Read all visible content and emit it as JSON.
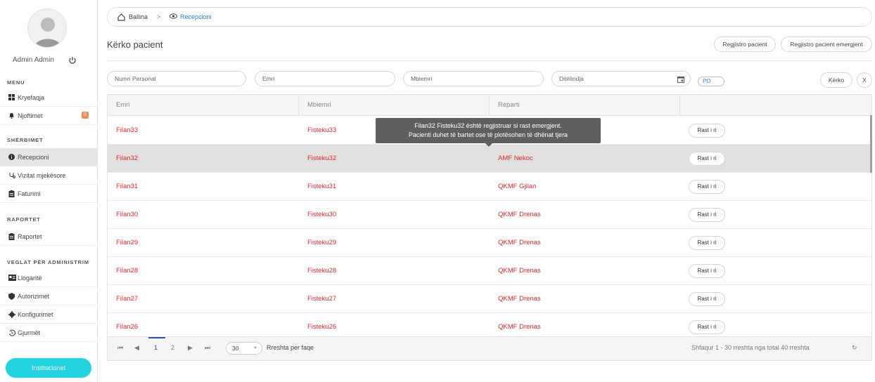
{
  "sidebar": {
    "user_name": "Admin Admin",
    "sections": {
      "menu": "MENU",
      "sherbimet": "SHËRBIMET",
      "raportet": "RAPORTET",
      "veglat": "VEGLAT PËR ADMINISTRIM"
    },
    "items": [
      {
        "label": "Kryefaqja",
        "icon": "dashboard-icon"
      },
      {
        "label": "Njoftimet",
        "icon": "bell-icon",
        "badge": "0"
      },
      {
        "label": "Recepcioni",
        "icon": "info-circle-icon",
        "active": true
      },
      {
        "label": "Vizitat mjekësore",
        "icon": "stethoscope-icon"
      },
      {
        "label": "Faturimi",
        "icon": "clipboard-icon"
      },
      {
        "label": "Raportet",
        "icon": "clipboard-icon"
      },
      {
        "label": "Llogaritë",
        "icon": "id-card-icon"
      },
      {
        "label": "Autorizimet",
        "icon": "shield-icon"
      },
      {
        "label": "Konfigurimet",
        "icon": "gear-icon"
      },
      {
        "label": "Gjurmët",
        "icon": "history-icon"
      }
    ],
    "institucionet_label": "Institucionet"
  },
  "breadcrumb": {
    "home": "Ballina",
    "separator": ">",
    "current": "Recepcioni"
  },
  "page": {
    "title": "Kërko pacient",
    "register_label": "Regjistro pacient",
    "register_emergency_label": "Regjistro pacient emergjent"
  },
  "filters": {
    "personal_number": "Numri Personal",
    "first_name": "Emri",
    "last_name": "Mbiemri",
    "birth_date": "Ditëlindja",
    "po": "PO",
    "search_label": "Kërko",
    "clear_label": "X"
  },
  "table": {
    "headers": [
      "Emri",
      "Mbiemri",
      "Reparti",
      ""
    ],
    "action_label": "Rast i ri",
    "rows": [
      {
        "emri": "Filan33",
        "mbiemri": "Fisteku33",
        "reparti": ""
      },
      {
        "emri": "Filan32",
        "mbiemri": "Fisteku32",
        "reparti": "AMF Nekoc"
      },
      {
        "emri": "Filan31",
        "mbiemri": "Fisteku31",
        "reparti": "QKMF Gjilan"
      },
      {
        "emri": "Filan30",
        "mbiemri": "Fisteku30",
        "reparti": "QKMF Drenas"
      },
      {
        "emri": "Filan29",
        "mbiemri": "Fisteku29",
        "reparti": "QKMF Drenas"
      },
      {
        "emri": "Filan28",
        "mbiemri": "Fisteku28",
        "reparti": "QKMF Drenas"
      },
      {
        "emri": "Filan27",
        "mbiemri": "Fisteku27",
        "reparti": "QKMF Drenas"
      },
      {
        "emri": "Filan26",
        "mbiemri": "Fisteku26",
        "reparti": "QKMF Drenas"
      }
    ],
    "tooltip_line1": "Filan32 Fisteku32 është regjistruar si rast emergjent.",
    "tooltip_line2": "Pacienti duhet të bartet ose të plotësohen të dhënat tjera"
  },
  "pager": {
    "page1": "1",
    "page2": "2",
    "page_size": "30",
    "per_page_label": "Rreshta per faqe",
    "summary": "Shfaqur 1 - 30 rreshta nga total 40 rreshta"
  },
  "colors": {
    "accent": "#22d3e0",
    "row_text": "#e8262a",
    "link": "#2a7ee0"
  }
}
